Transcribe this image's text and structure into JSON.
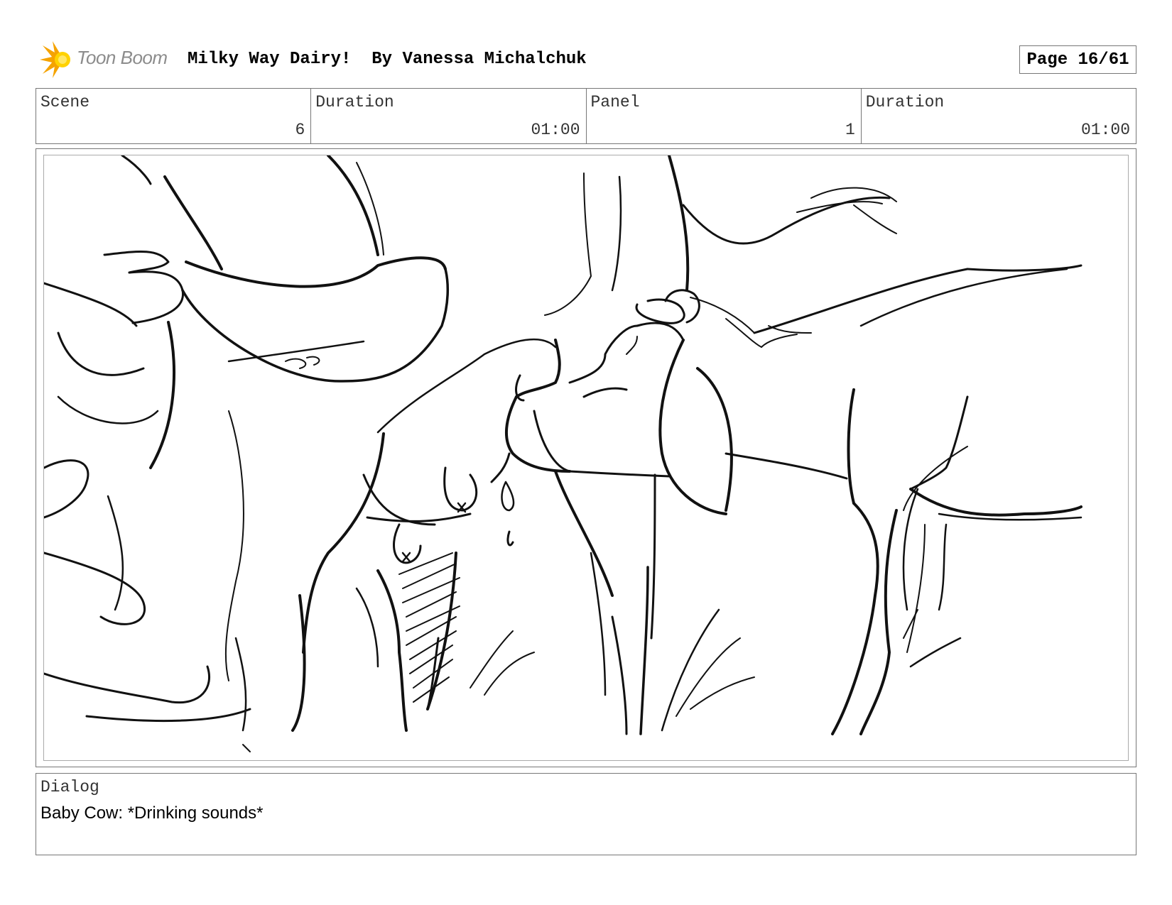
{
  "header": {
    "logo_text": "Toon Boom",
    "title": "Milky Way Dairy!  By Vanessa Michalchuk",
    "page": "Page 16/61"
  },
  "info": {
    "scene_label": "Scene",
    "scene_value": "6",
    "duration_label": "Duration",
    "duration_value": "01:00",
    "panel_label": "Panel",
    "panel_value": "1",
    "panel_duration_label": "Duration",
    "panel_duration_value": "01:00"
  },
  "panel": {
    "image_icon": "storyboard-sketch"
  },
  "dialog": {
    "label": "Dialog",
    "text": "Baby Cow: *Drinking sounds*"
  },
  "colors": {
    "logo_orange": "#f5a300",
    "logo_yellow": "#ffd200",
    "logo_text": "#8c8c8c",
    "border": "#777777"
  }
}
